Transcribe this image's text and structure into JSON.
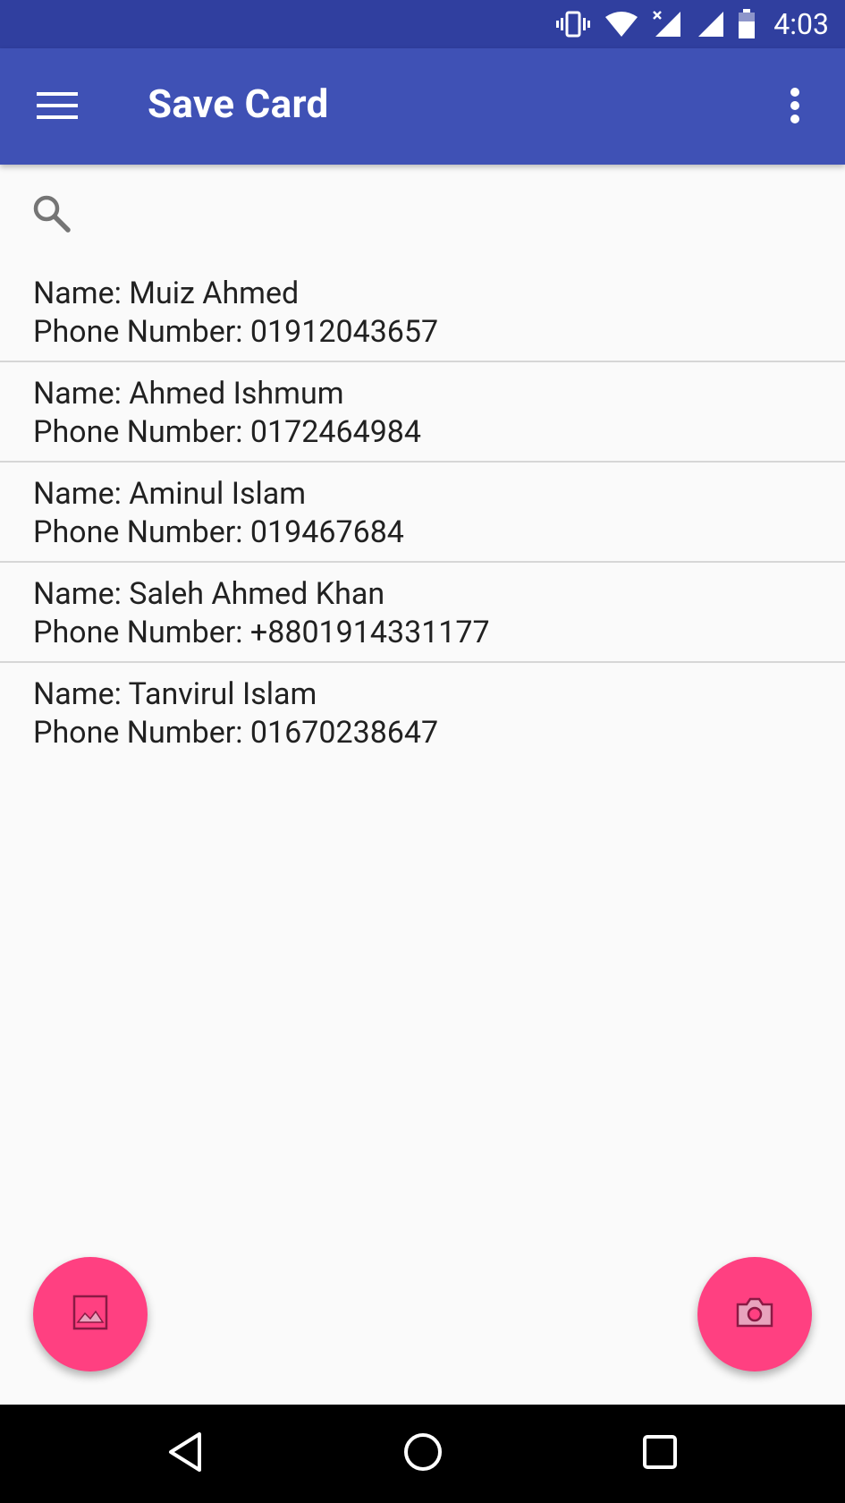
{
  "status_bar": {
    "time": "4:03",
    "icons": [
      "vibrate-icon",
      "wifi-icon",
      "signal-no-data-icon",
      "signal-icon",
      "battery-icon"
    ]
  },
  "app_bar": {
    "title": "Save Card",
    "menu_icon": "hamburger-menu-icon",
    "overflow_icon": "more-vert-icon"
  },
  "search": {
    "icon": "search-icon"
  },
  "contacts": [
    {
      "name_line": "Name: Muiz Ahmed",
      "phone_line": "Phone Number: 01912043657"
    },
    {
      "name_line": "Name: Ahmed Ishmum",
      "phone_line": "Phone Number: 0172464984"
    },
    {
      "name_line": "Name: Aminul Islam",
      "phone_line": "Phone Number: 019467684"
    },
    {
      "name_line": "Name: Saleh Ahmed Khan",
      "phone_line": "Phone Number: +8801914331177"
    },
    {
      "name_line": "Name: Tanvirul Islam",
      "phone_line": "Phone Number: 01670238647"
    }
  ],
  "fabs": {
    "gallery_icon": "image-icon",
    "camera_icon": "camera-icon"
  },
  "nav_bar": {
    "icons": [
      "back-icon",
      "home-icon",
      "recents-icon"
    ]
  },
  "colors": {
    "status_bar": "#303f9f",
    "app_bar": "#3f51b5",
    "accent": "#ff4081",
    "background": "#fafafa",
    "text": "#212121",
    "divider": "#d6d6d6"
  }
}
